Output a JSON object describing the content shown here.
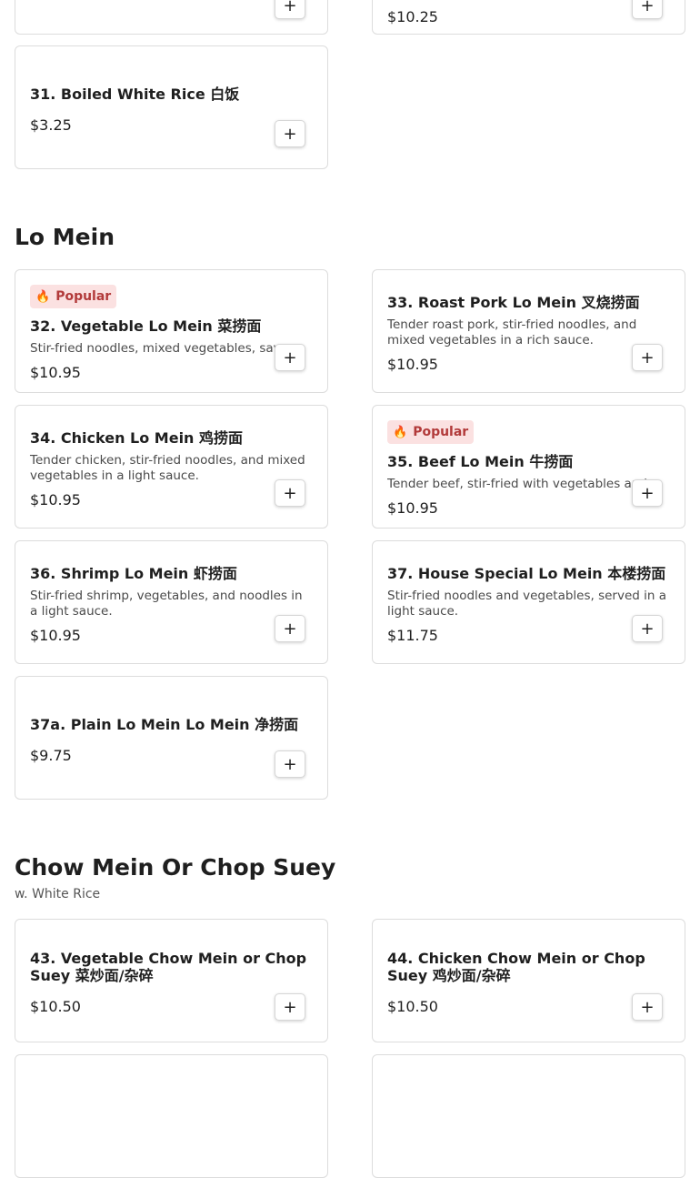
{
  "common": {
    "add_label": "+",
    "popular_label": "Popular",
    "popular_icon": "flame-icon"
  },
  "top": {
    "right_price": "$10.25",
    "item31": {
      "name": "31. Boiled White Rice 白饭",
      "price": "$3.25"
    }
  },
  "lo_mein": {
    "title": "Lo Mein",
    "items": [
      {
        "name": "32. Vegetable Lo Mein 菜捞面",
        "desc": "Stir-fried noodles, mixed vegetables, savory sauce.",
        "price": "$10.95",
        "popular": true
      },
      {
        "name": "33. Roast Pork Lo Mein 叉烧捞面",
        "desc": "Tender roast pork, stir-fried noodles, and mixed vegetables in a rich sauce.",
        "price": "$10.95"
      },
      {
        "name": "34. Chicken Lo Mein 鸡捞面",
        "desc": "Tender chicken, stir-fried noodles, and mixed vegetables in a light sauce.",
        "price": "$10.95"
      },
      {
        "name": "35. Beef Lo Mein 牛捞面",
        "desc": "Tender beef, stir-fried with vegetables and noodles.",
        "price": "$10.95",
        "popular": true
      },
      {
        "name": "36. Shrimp Lo Mein 虾捞面",
        "desc": "Stir-fried shrimp, vegetables, and noodles in a light sauce.",
        "price": "$10.95"
      },
      {
        "name": "37. House Special Lo Mein 本楼捞面",
        "desc": "Stir-fried noodles and vegetables, served in a light sauce.",
        "price": "$11.75"
      },
      {
        "name": "37a. Plain Lo Mein Lo Mein 净捞面",
        "price": "$9.75"
      }
    ]
  },
  "chow_mein": {
    "title": "Chow Mein Or Chop Suey",
    "subtitle": "w. White Rice",
    "items": [
      {
        "name": "43. Vegetable Chow Mein or Chop Suey 菜炒面/杂碎",
        "price": "$10.50"
      },
      {
        "name": "44. Chicken Chow Mein or Chop Suey 鸡炒面/杂碎",
        "price": "$10.50"
      }
    ]
  }
}
